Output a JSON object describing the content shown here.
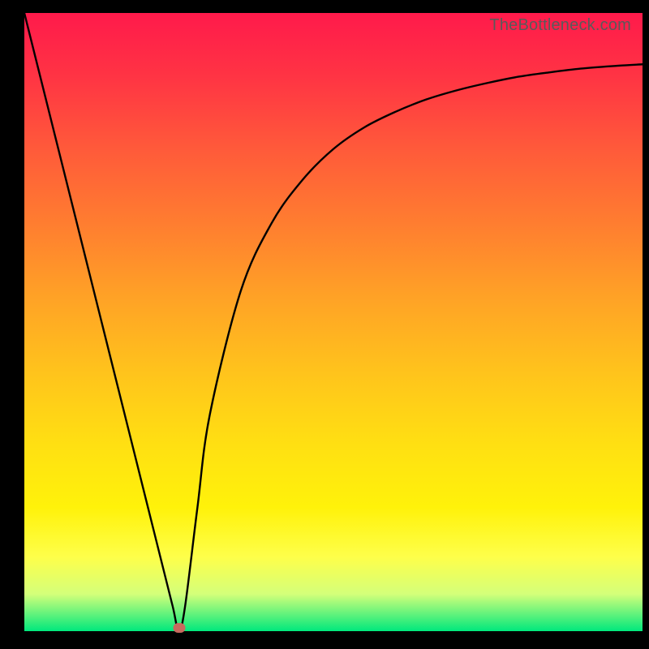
{
  "watermark": "TheBottleneck.com",
  "chart_data": {
    "type": "line",
    "title": "",
    "xlabel": "",
    "ylabel": "",
    "xlim": [
      0,
      100
    ],
    "ylim": [
      0,
      100
    ],
    "x": [
      0,
      5,
      10,
      15,
      20,
      22,
      24,
      25,
      26,
      28,
      30,
      35,
      40,
      45,
      50,
      55,
      60,
      65,
      70,
      75,
      80,
      85,
      90,
      95,
      100
    ],
    "values": [
      100,
      80,
      60,
      40,
      20,
      12,
      4,
      0,
      4,
      20,
      35,
      55,
      66,
      73,
      78,
      81.5,
      84,
      86,
      87.5,
      88.7,
      89.7,
      90.4,
      91,
      91.4,
      91.7
    ],
    "marker": {
      "x": 25,
      "y": 0
    },
    "series": [
      {
        "name": "curve",
        "color": "#000000"
      }
    ],
    "colors": {
      "gradient_top": "#ff1a4b",
      "gradient_mid": "#ffe012",
      "gradient_bottom": "#00e87d",
      "marker": "#c76a5e"
    }
  }
}
